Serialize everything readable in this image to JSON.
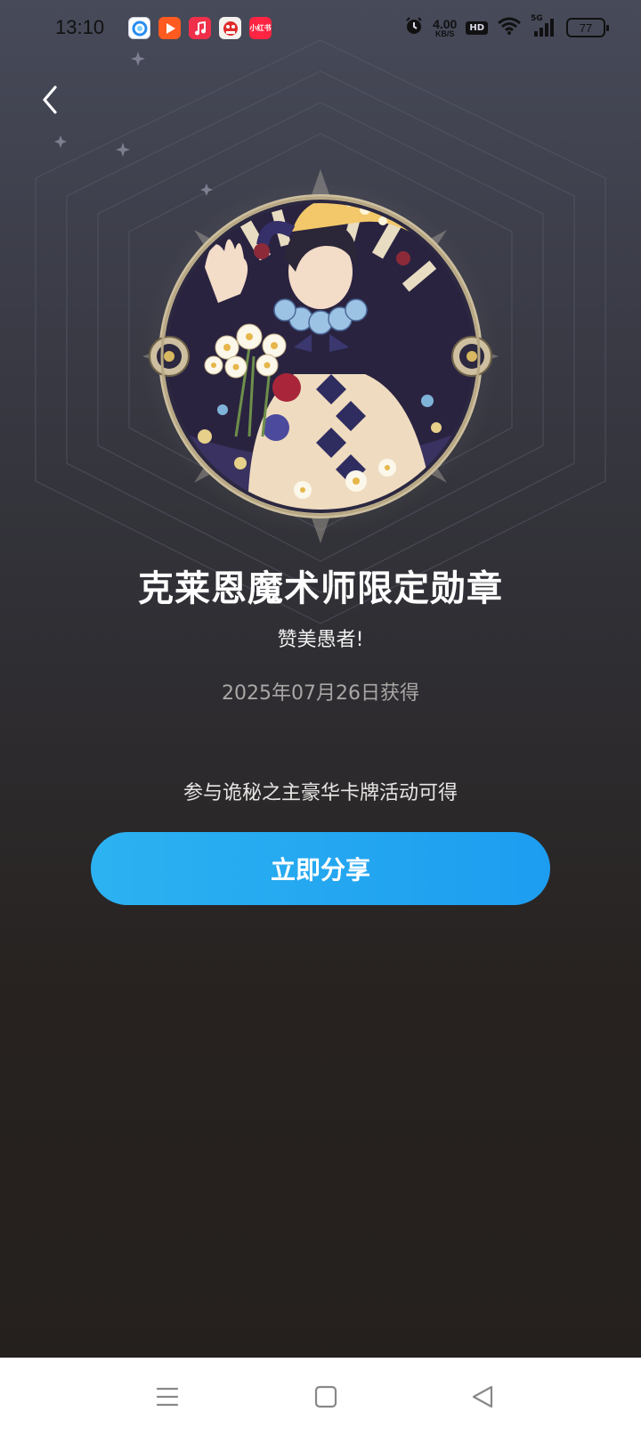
{
  "status_bar": {
    "time": "13:10",
    "notification_apps": [
      "browser-app-icon",
      "video-app-icon",
      "music-app-icon",
      "game-app-icon",
      "xiaohongshu-app-icon"
    ],
    "xiaohongshu_label": "小红书",
    "net_speed_value": "4.00",
    "net_speed_unit": "KB/S",
    "hd_label": "HD",
    "signal_label": "5G",
    "battery_level": "77"
  },
  "badge": {
    "title": "克莱恩魔术师限定勋章",
    "subtitle": "赞美愚者!",
    "obtained_date": "2025年07月26日获得",
    "description": "参与诡秘之主豪华卡牌活动可得",
    "share_label": "立即分享"
  },
  "colors": {
    "button_start": "#2cb2f1",
    "button_end": "#1d9df0",
    "background_top": "#474a59",
    "background_bottom": "#24201e"
  }
}
